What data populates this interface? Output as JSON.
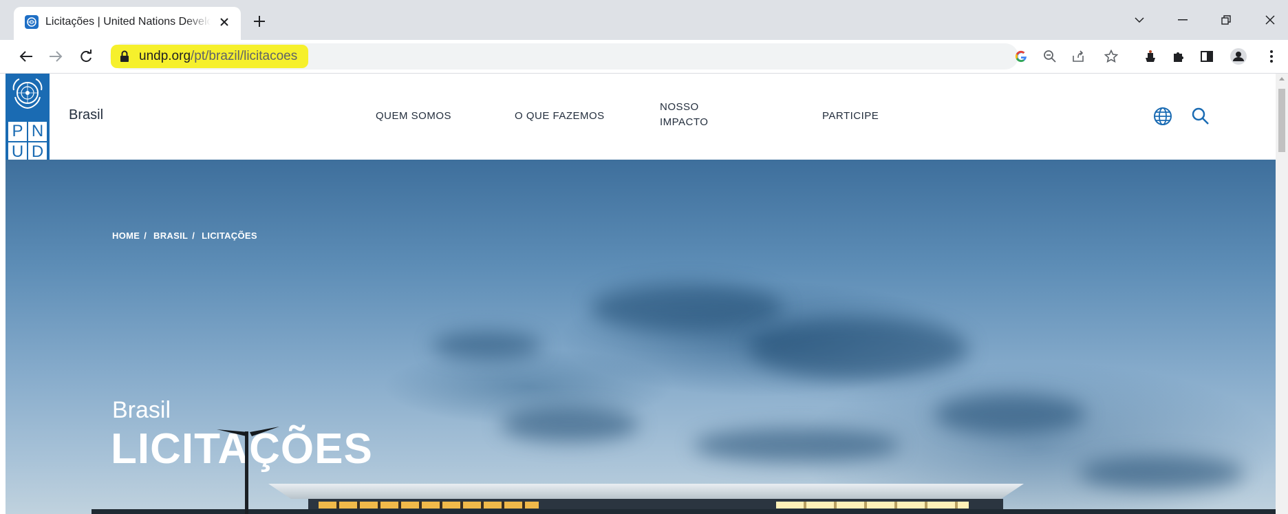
{
  "browser": {
    "tab": {
      "title": "Licitações | United Nations Development Programme",
      "favicon": "un-emblem-icon"
    },
    "address": {
      "url_domain": "undp.org",
      "url_path": "/pt/brazil/licitacoes",
      "highlight_color": "#f6f02c"
    },
    "icons": [
      "back-arrow-icon",
      "forward-arrow-icon",
      "reload-icon",
      "lock-icon",
      "google-icon",
      "zoom-out-icon",
      "share-icon",
      "star-icon",
      "extension-icon",
      "puzzle-icon",
      "side-panel-icon",
      "profile-icon",
      "kebab-menu-icon"
    ]
  },
  "site": {
    "logo": {
      "letters": [
        "P",
        "N",
        "U",
        "D"
      ],
      "color": "#1a6bb3"
    },
    "brand": "Brasil",
    "nav": {
      "quem_somos": "QUEM SOMOS",
      "o_que_fazemos": "O QUE FAZEMOS",
      "nosso": "NOSSO",
      "impacto": "IMPACTO",
      "participe": "PARTICIPE"
    },
    "accent_color": "#1a6bb3"
  },
  "hero": {
    "breadcrumb": {
      "home": "HOME",
      "brasil": "BRASIL",
      "licitacoes": "LICITAÇÕES",
      "separator": "/"
    },
    "subtitle": "Brasil",
    "title": "LICITAÇÕES"
  }
}
